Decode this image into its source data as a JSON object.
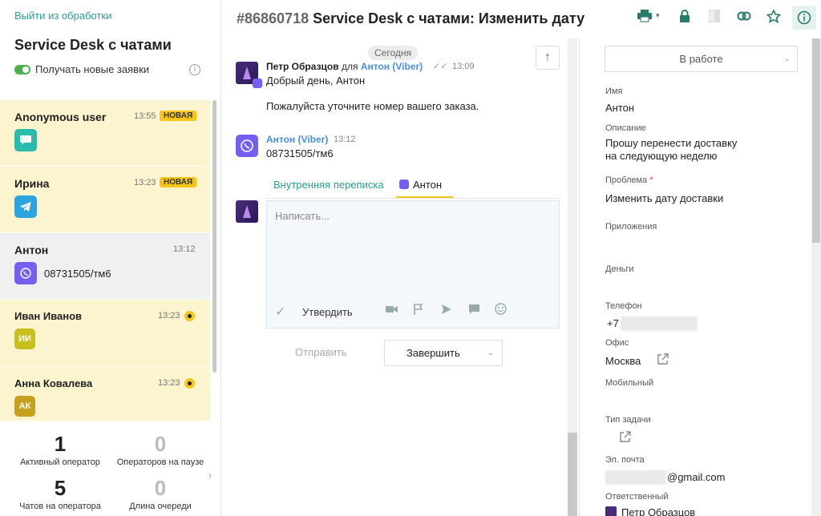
{
  "left": {
    "exit_link": "Выйти из обработки",
    "title": "Service Desk с чатами",
    "toggle_label": "Получать новые заявки",
    "items": [
      {
        "name": "Anonymous user",
        "time": "13:55",
        "badge": "НОВАЯ",
        "channel": "chat-icon",
        "color": "#2bbbad"
      },
      {
        "name": "Ирина",
        "time": "13:23",
        "badge": "НОВАЯ",
        "channel": "telegram-icon",
        "color": "#2ba5e0"
      },
      {
        "name": "Антон",
        "time": "13:12",
        "message": "08731505/тм6",
        "channel": "viber-icon",
        "color": "#7360f2"
      },
      {
        "name": "Иван Иванов",
        "time": "13:23",
        "initials": "ИИ",
        "color": "#c8c020"
      },
      {
        "name": "Анна Ковалева",
        "time": "13:23",
        "initials": "АК",
        "color": "#c8a020"
      }
    ],
    "stats": [
      {
        "value": "1",
        "label": "Активный оператор"
      },
      {
        "value": "0",
        "label": "Операторов на паузе"
      },
      {
        "value": "5",
        "label": "Чатов на оператора"
      },
      {
        "value": "0",
        "label": "Длина очереди"
      }
    ]
  },
  "header": {
    "ticket_number": "#86860718",
    "ticket_title": "Service Desk с чатами: Изменить дату"
  },
  "chat": {
    "date_badge": "Сегодня",
    "messages": [
      {
        "author": "Петр Образцов",
        "for_word": "для",
        "recipient": "Антон (Viber)",
        "time": "13:09",
        "lines": [
          "Добрый день, Антон",
          "Пожалуйста уточните номер вашего заказа."
        ]
      },
      {
        "author": "Антон (Viber)",
        "time": "13:12",
        "lines": [
          "08731505/тм6"
        ]
      }
    ],
    "tabs": [
      "Внутренняя переписка",
      "Антон"
    ],
    "placeholder": "Написать...",
    "approve_label": "Утвердить",
    "send_label": "Отправить",
    "finish_label": "Завершить"
  },
  "details": {
    "status": "В работе",
    "fields": [
      {
        "label": "Имя",
        "value": "Антон"
      },
      {
        "label": "Описание",
        "value": "Прошу перенести доставку",
        "value2": "на следующую неделю"
      },
      {
        "label": "Проблема",
        "required": "*",
        "value": "Изменить дату доставки"
      },
      {
        "label": "Приложения",
        "value": ""
      },
      {
        "label": "Деньги",
        "value": ""
      },
      {
        "label": "Телефон",
        "value": "+7"
      },
      {
        "label": "Офис",
        "value": "Москва"
      },
      {
        "label": "Мобильный",
        "value": ""
      },
      {
        "label": "Тип задачи",
        "value": ""
      },
      {
        "label": "Эл. почта",
        "value": "@gmail.com"
      },
      {
        "label": "Ответственный",
        "value": "Петр Образцов"
      }
    ]
  }
}
